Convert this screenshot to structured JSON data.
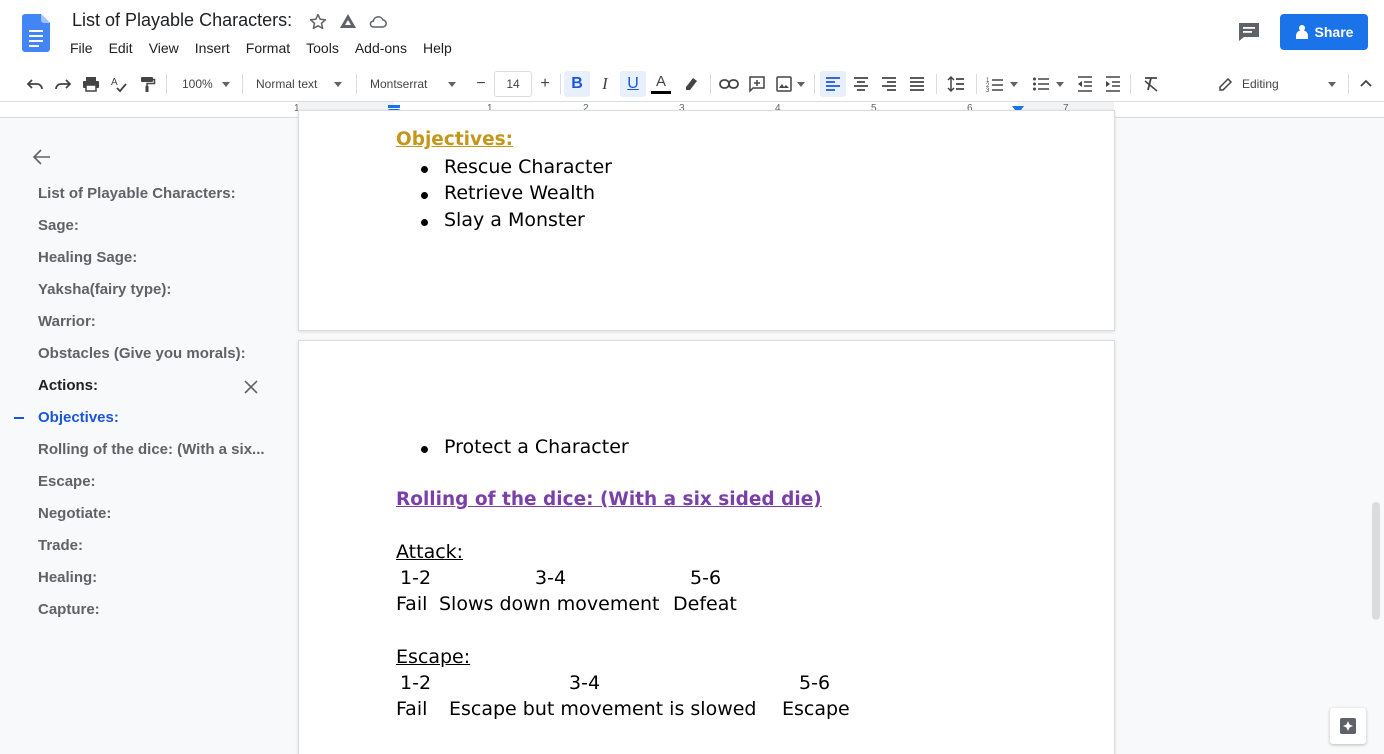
{
  "app": {
    "doc_title": "List of Playable Characters:",
    "share_label": "Share",
    "brand_color": "#1a73e8"
  },
  "menu": [
    "File",
    "Edit",
    "View",
    "Insert",
    "Format",
    "Tools",
    "Add-ons",
    "Help"
  ],
  "toolbar": {
    "zoom": "100%",
    "style": "Normal text",
    "font": "Montserrat",
    "font_size": "14",
    "mode": "Editing",
    "icons": [
      "undo-icon",
      "redo-icon",
      "print-icon",
      "spellcheck-icon",
      "paint-format-icon",
      "bold-icon",
      "italic-icon",
      "underline-icon",
      "text-color-icon",
      "highlight-icon",
      "link-icon",
      "comment-icon",
      "image-icon",
      "align-left-icon",
      "align-center-icon",
      "align-right-icon",
      "justify-icon",
      "line-spacing-icon",
      "numbered-list-icon",
      "bulleted-list-icon",
      "decrease-indent-icon",
      "increase-indent-icon",
      "clear-formatting-icon",
      "pencil-icon"
    ]
  },
  "ruler": [
    "1",
    "1",
    "2",
    "3",
    "4",
    "5",
    "6",
    "7"
  ],
  "outline": {
    "items": [
      "List of Playable Characters:",
      "Sage:",
      "Healing Sage:",
      "Yaksha(fairy type):",
      "Warrior:",
      "Obstacles (Give you morals):",
      "Actions:",
      "Objectives:",
      "Rolling of the dice: (With a six...",
      "Escape:",
      "Negotiate:",
      "Trade:",
      "Healing:",
      "Capture:"
    ],
    "current": "Objectives:"
  },
  "document": {
    "page1": {
      "heading": "Objectives:",
      "heading_color": "#c4961a",
      "bullets": [
        "Rescue Character",
        "Retrieve Wealth",
        "Slay a Monster"
      ]
    },
    "page2": {
      "bullets": [
        "Protect a Character"
      ],
      "heading": "Rolling of the dice: (With a six sided die)",
      "heading_color": "#7b3fa8",
      "attack": {
        "title": "Attack:",
        "rolls": [
          "1-2",
          "3-4",
          "5-6"
        ],
        "results": [
          "Fail",
          "Slows down movement",
          "Defeat"
        ]
      },
      "escape": {
        "title": "Escape:",
        "rolls": [
          "1-2",
          "3-4",
          "5-6"
        ],
        "results": [
          "Fail",
          "Escape but movement is slowed",
          "Escape"
        ]
      }
    }
  }
}
